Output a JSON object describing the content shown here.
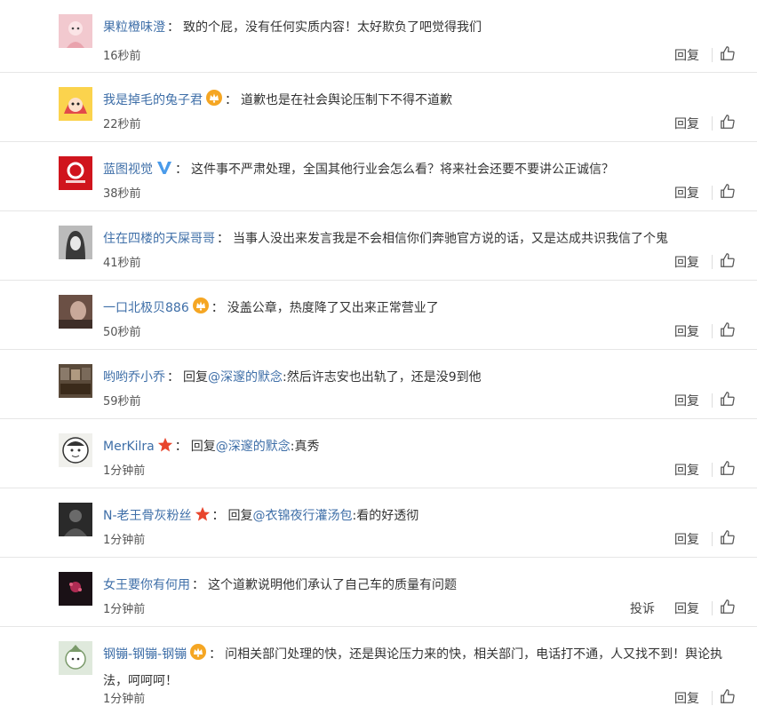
{
  "comments": [
    {
      "user": "果粒橙味澄",
      "badge": "",
      "reply_prefix": "",
      "mention": "",
      "text": "致的个屁，没有任何实质内容！太好欺负了吧觉得我们",
      "time": "16秒前",
      "avatar_color": "#f2c9cf",
      "reply": "回复",
      "report": ""
    },
    {
      "user": "我是掉毛的兔子君",
      "badge": "crown-icon",
      "reply_prefix": "",
      "mention": "",
      "text": "道歉也是在社会舆论压制下不得不道歉",
      "time": "22秒前",
      "avatar_color": "#e24a4a",
      "reply": "回复",
      "report": ""
    },
    {
      "user": "蓝图视觉",
      "badge": "verified-v-icon",
      "reply_prefix": "",
      "mention": "",
      "text": "这件事不严肃处理，全国其他行业会怎么看？将来社会还要不要讲公正诚信？",
      "time": "38秒前",
      "avatar_color": "#d0141d",
      "reply": "回复",
      "report": ""
    },
    {
      "user": "住在四楼的天屎哥哥",
      "badge": "",
      "reply_prefix": "",
      "mention": "",
      "text": "当事人没出来发言我是不会相信你们奔驰官方说的话，又是达成共识我信了个鬼",
      "time": "41秒前",
      "avatar_color": "#3a3a3a",
      "reply": "回复",
      "report": ""
    },
    {
      "user": "一口北极贝886",
      "badge": "crown-icon",
      "reply_prefix": "",
      "mention": "",
      "text": "没盖公章，热度降了又出来正常营业了",
      "time": "50秒前",
      "avatar_color": "#6b5045",
      "reply": "回复",
      "report": ""
    },
    {
      "user": "哟哟乔小乔",
      "badge": "",
      "reply_prefix": "回复",
      "mention": "@深邃的默念",
      "text": ":然后许志安也出轨了，还是没9到他",
      "time": "59秒前",
      "avatar_color": "#5a4a3a",
      "reply": "回复",
      "report": ""
    },
    {
      "user": "MerKilra",
      "badge": "star-icon",
      "reply_prefix": "回复",
      "mention": "@深邃的默念",
      "text": ":真秀",
      "time": "1分钟前",
      "avatar_color": "#f0f0ec",
      "reply": "回复",
      "report": ""
    },
    {
      "user": "N-老王骨灰粉丝",
      "badge": "star-icon",
      "reply_prefix": "回复",
      "mention": "@衣锦夜行灌汤包",
      "text": ":看的好透彻",
      "time": "1分钟前",
      "avatar_color": "#2a2a2a",
      "reply": "回复",
      "report": ""
    },
    {
      "user": "女王要你有何用",
      "badge": "",
      "reply_prefix": "",
      "mention": "",
      "text": "这个道歉说明他们承认了自己车的质量有问题",
      "time": "1分钟前",
      "avatar_color": "#1a1116",
      "reply": "回复",
      "report": "投诉"
    },
    {
      "user": "钢镚-钢镚-钢镚",
      "badge": "crown-icon",
      "reply_prefix": "",
      "mention": "",
      "text": "问相关部门处理的快，还是舆论压力来的快，相关部门，电话打不通，人又找不到！舆论执法，呵呵呵！",
      "time": "1分钟前",
      "avatar_color": "#dfe9dc",
      "reply": "回复",
      "report": ""
    }
  ],
  "colors": {
    "link": "#3f6fa8",
    "divider": "#e6e6e6",
    "text": "#333333",
    "time": "#555555",
    "verified": "#4a9bea",
    "crown": "#f5a623",
    "star": "#e8452c"
  }
}
